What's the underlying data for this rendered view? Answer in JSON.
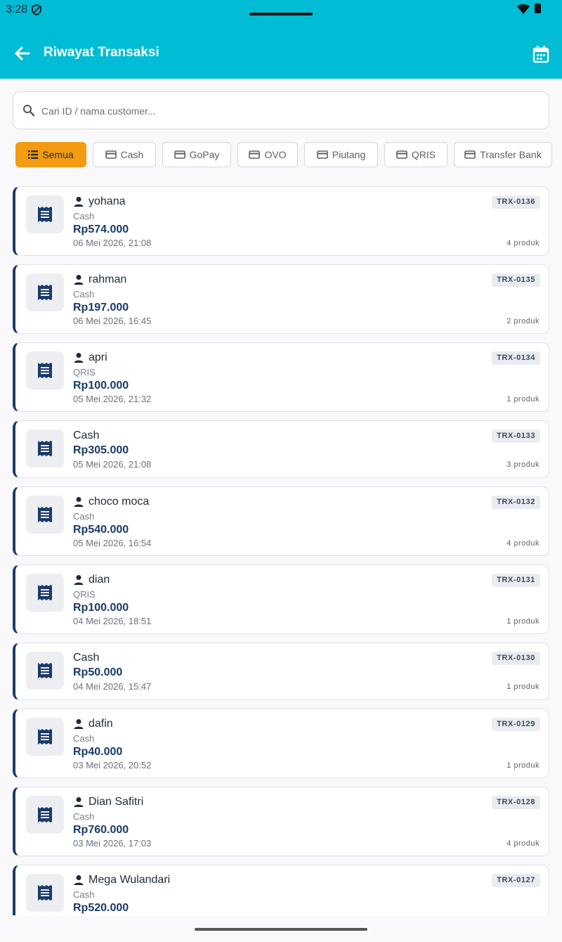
{
  "status_bar": {
    "time": "3:28"
  },
  "app_bar": {
    "title": "Riwayat Transaksi",
    "back_icon": "arrow-back-icon",
    "calendar_icon": "calendar-icon"
  },
  "search": {
    "placeholder": "Cari ID / nama customer...",
    "value": ""
  },
  "filters": [
    {
      "label": "Semua",
      "icon": "list-icon",
      "active": true
    },
    {
      "label": "Cash",
      "icon": "card-icon",
      "active": false
    },
    {
      "label": "GoPay",
      "icon": "card-icon",
      "active": false
    },
    {
      "label": "OVO",
      "icon": "card-icon",
      "active": false
    },
    {
      "label": "Piutang",
      "icon": "card-icon",
      "active": false
    },
    {
      "label": "QRIS",
      "icon": "card-icon",
      "active": false
    },
    {
      "label": "Transfer Bank",
      "icon": "card-icon",
      "active": false
    }
  ],
  "transactions": [
    {
      "customer": "yohana",
      "method": "Cash",
      "amount": "Rp574.000",
      "date": "06 Mei 2026, 21:08",
      "id": "TRX-0136",
      "items": "4 produk"
    },
    {
      "customer": "rahman",
      "method": "Cash",
      "amount": "Rp197.000",
      "date": "06 Mei 2026, 16:45",
      "id": "TRX-0135",
      "items": "2 produk"
    },
    {
      "customer": "apri",
      "method": "QRIS",
      "amount": "Rp100.000",
      "date": "05 Mei 2026, 21:32",
      "id": "TRX-0134",
      "items": "1 produk"
    },
    {
      "customer": "",
      "method": "Cash",
      "amount": "Rp305.000",
      "date": "05 Mei 2026, 21:08",
      "id": "TRX-0133",
      "items": "3 produk"
    },
    {
      "customer": "choco moca",
      "method": "Cash",
      "amount": "Rp540.000",
      "date": "05 Mei 2026, 16:54",
      "id": "TRX-0132",
      "items": "4 produk"
    },
    {
      "customer": "dian",
      "method": "QRIS",
      "amount": "Rp100.000",
      "date": "04 Mei 2026, 18:51",
      "id": "TRX-0131",
      "items": "1 produk"
    },
    {
      "customer": "",
      "method": "Cash",
      "amount": "Rp50.000",
      "date": "04 Mei 2026, 15:47",
      "id": "TRX-0130",
      "items": "1 produk"
    },
    {
      "customer": "dafin",
      "method": "Cash",
      "amount": "Rp40.000",
      "date": "03 Mei 2026, 20:52",
      "id": "TRX-0129",
      "items": "1 produk"
    },
    {
      "customer": "Dian Safitri",
      "method": "Cash",
      "amount": "Rp760.000",
      "date": "03 Mei 2026, 17:03",
      "id": "TRX-0128",
      "items": "4 produk"
    },
    {
      "customer": "Mega Wulandari",
      "method": "Cash",
      "amount": "Rp520.000",
      "date": "",
      "id": "TRX-0127",
      "items": ""
    }
  ]
}
